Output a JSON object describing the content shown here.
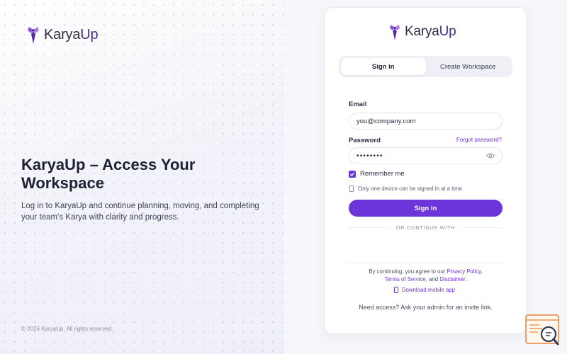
{
  "brand": {
    "name_prefix": "Karya",
    "name_suffix": "Up",
    "accent": "#6b35d9"
  },
  "left": {
    "headline": "KaryaUp – Access Your Workspace",
    "subtext": "Log in to KaryaUp and continue planning, moving, and completing your team's Karya with clarity and progress.",
    "copyright": "© 2026 KaryaUp. All rights reserved."
  },
  "tabs": [
    {
      "label": "Sign in",
      "active": true
    },
    {
      "label": "Create Workspace",
      "active": false
    }
  ],
  "form": {
    "email_label": "Email",
    "email_value": "you@company.com",
    "password_label": "Password",
    "forgot_label": "Forgot password?",
    "password_value": "••••••••",
    "remember_label": "Remember me",
    "remember_checked": true,
    "device_note": "Only one device can be signed in at a time.",
    "submit_label": "Sign in",
    "divider_label": "OR CONTINUE WITH"
  },
  "footer": {
    "terms_prefix": "By continuing, you agree to our",
    "privacy_label": "Privacy Policy",
    "terms_label": "Terms of Service",
    "and_text": ", and",
    "disclaimer_label": "Disclaimer",
    "download_label": "Download mobile app",
    "access_text": "Need access? Ask your admin for an invite link."
  },
  "icons": {
    "logo": "karyaup-logo-icon",
    "eye": "eye-icon",
    "phone": "phone-icon",
    "check": "check-icon",
    "widget": "search-chat-widget-icon"
  }
}
